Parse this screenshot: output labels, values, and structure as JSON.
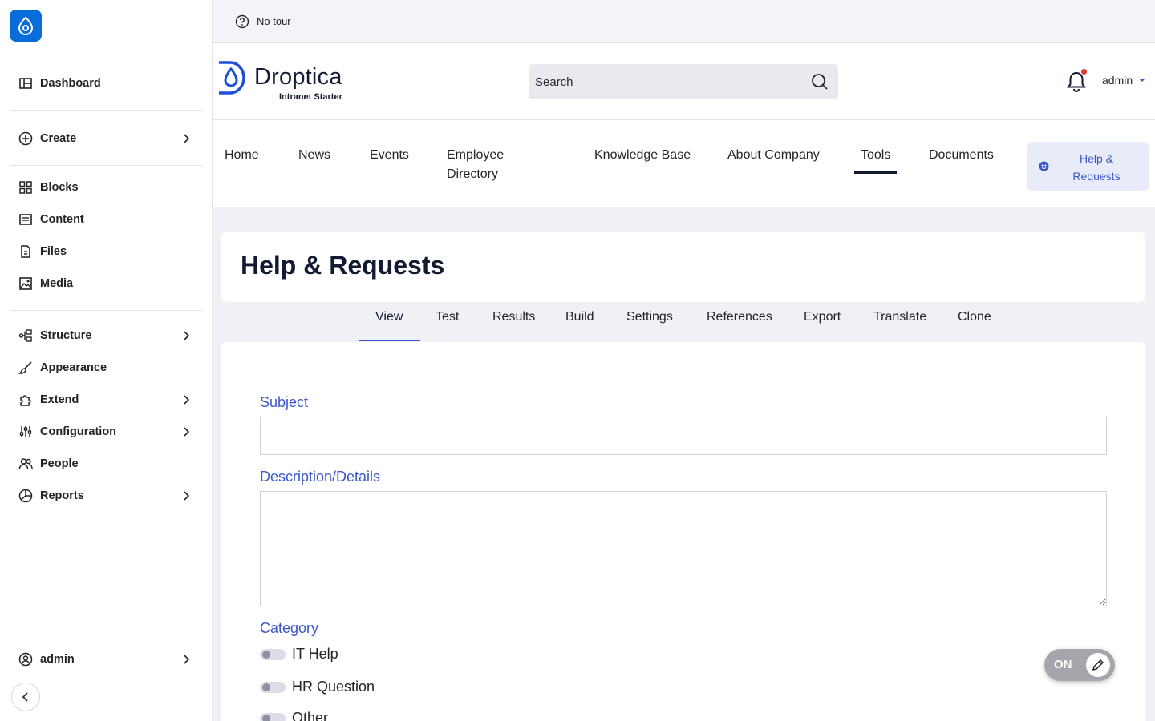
{
  "sidebar": {
    "items": [
      {
        "label": "Dashboard",
        "icon": "dashboard-icon"
      },
      {
        "label": "Create",
        "icon": "plus-circle-icon"
      },
      {
        "label": "Blocks",
        "icon": "blocks-icon"
      },
      {
        "label": "Content",
        "icon": "content-icon"
      },
      {
        "label": "Files",
        "icon": "file-icon"
      },
      {
        "label": "Media",
        "icon": "media-icon"
      },
      {
        "label": "Structure",
        "icon": "structure-icon"
      },
      {
        "label": "Appearance",
        "icon": "brush-icon"
      },
      {
        "label": "Extend",
        "icon": "puzzle-icon"
      },
      {
        "label": "Configuration",
        "icon": "sliders-icon"
      },
      {
        "label": "People",
        "icon": "people-icon"
      },
      {
        "label": "Reports",
        "icon": "chart-pie-icon"
      }
    ],
    "user": "admin"
  },
  "toolbar": {
    "tour_label": "No tour"
  },
  "header": {
    "brand_name": "Droptica",
    "brand_sub": "Intranet Starter",
    "search_placeholder": "Search",
    "user": "admin",
    "accent_color": "#3b57c7"
  },
  "nav": {
    "links": [
      "Home",
      "News",
      "Events",
      "Employee Directory",
      "Knowledge Base",
      "About Company",
      "Tools",
      "Documents"
    ],
    "active": "Tools",
    "help_button": "Help & Requests"
  },
  "page": {
    "title": "Help & Requests",
    "tabs": [
      "View",
      "Test",
      "Results",
      "Build",
      "Settings",
      "References",
      "Export",
      "Translate",
      "Clone"
    ],
    "active_tab": "View"
  },
  "form": {
    "subject_label": "Subject",
    "description_label": "Description/Details",
    "category_label": "Category",
    "categories": [
      "IT Help",
      "HR Question",
      "Other"
    ]
  },
  "floating": {
    "on_label": "ON"
  }
}
